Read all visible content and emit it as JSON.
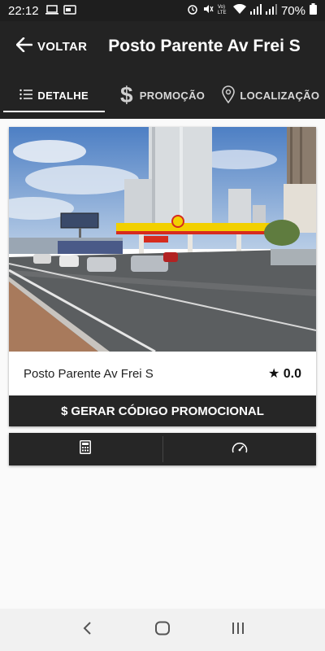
{
  "status_bar": {
    "time": "22:12",
    "battery_percent": "70%",
    "icons": [
      "laptop-icon",
      "cast-icon",
      "alarm-icon",
      "mute-icon",
      "volte-icon",
      "wifi-icon",
      "signal-icon",
      "battery-icon"
    ]
  },
  "app_bar": {
    "back_label": "VOLTAR",
    "title": "Posto Parente Av Frei S"
  },
  "tabs": [
    {
      "label": "DETALHE",
      "icon": "list-icon",
      "active": true
    },
    {
      "label": "PROMOÇÃO",
      "icon": "dollar-icon",
      "active": false
    },
    {
      "label": "LOCALIZAÇÃO",
      "icon": "location-pin-icon",
      "active": false
    }
  ],
  "card": {
    "station_name": "Posto Parente Av Frei S",
    "rating_star": "★",
    "rating_value": "0.0",
    "promo_dollar": "$",
    "promo_button": "GERAR CÓDIGO PROMOCIONAL"
  },
  "actions": [
    {
      "icon": "calculator-icon"
    },
    {
      "icon": "speedometer-icon"
    }
  ],
  "nav": [
    "back-nav-icon",
    "home-nav-icon",
    "recents-nav-icon"
  ],
  "colors": {
    "app_bar": "#232323",
    "button": "#262626",
    "background": "#fafafa"
  }
}
